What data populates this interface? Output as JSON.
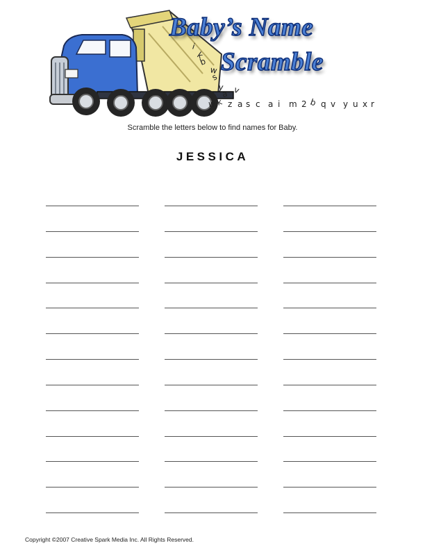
{
  "header": {
    "title_line1": "Baby’s Name",
    "title_line2": "Scramble",
    "illustration": "dump-truck-spilling-letters",
    "title_color": "#4a7fd4",
    "title_outline_color": "#0f2f78",
    "truck_cab_color": "#3b6fd1",
    "truck_bed_color": "#f1e7a3"
  },
  "instructions": "Scramble the letters below to find names for Baby.",
  "baby_name": "JESSICA",
  "answer_grid": {
    "rows": 13,
    "columns": 3
  },
  "footer": {
    "copyright": "Copyright ©2007  Creative Spark Media Inc.  All Rights Reserved."
  }
}
